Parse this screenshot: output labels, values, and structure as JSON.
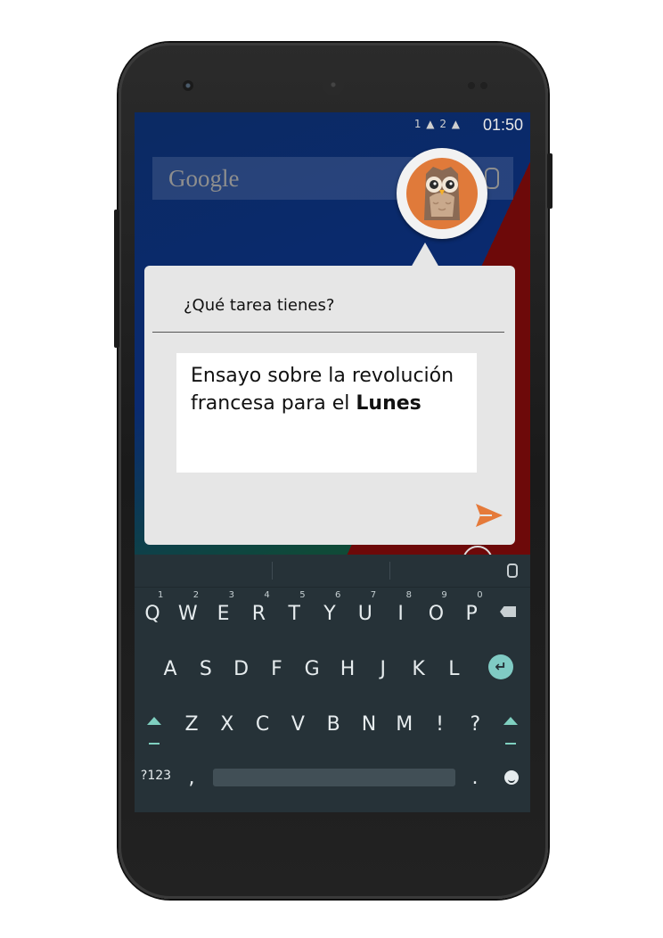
{
  "status_bar": {
    "sim_indicators": "1 ▲ 2 ▲",
    "time": "01:50"
  },
  "search_bar": {
    "logo_text": "Google"
  },
  "dialog": {
    "question": "¿Qué tarea tienes?",
    "answer_normal": "Ensayo sobre la revolución francesa para el ",
    "answer_bold": "Lunes",
    "send_icon": "send-arrow-icon",
    "accent_color": "#e57a3a"
  },
  "keyboard": {
    "row1": [
      "Q",
      "W",
      "E",
      "R",
      "T",
      "Y",
      "U",
      "I",
      "O",
      "P"
    ],
    "row1_hints": [
      "1",
      "2",
      "3",
      "4",
      "5",
      "6",
      "7",
      "8",
      "9",
      "0"
    ],
    "row2": [
      "A",
      "S",
      "D",
      "F",
      "G",
      "H",
      "J",
      "K",
      "L"
    ],
    "row3": [
      "Z",
      "X",
      "C",
      "V",
      "B",
      "N",
      "M",
      "!",
      "?"
    ],
    "symbols_key": "?123",
    "comma_key": ",",
    "period_key": ".",
    "bg_color": "#263238",
    "accent_color": "#80cbc4"
  }
}
